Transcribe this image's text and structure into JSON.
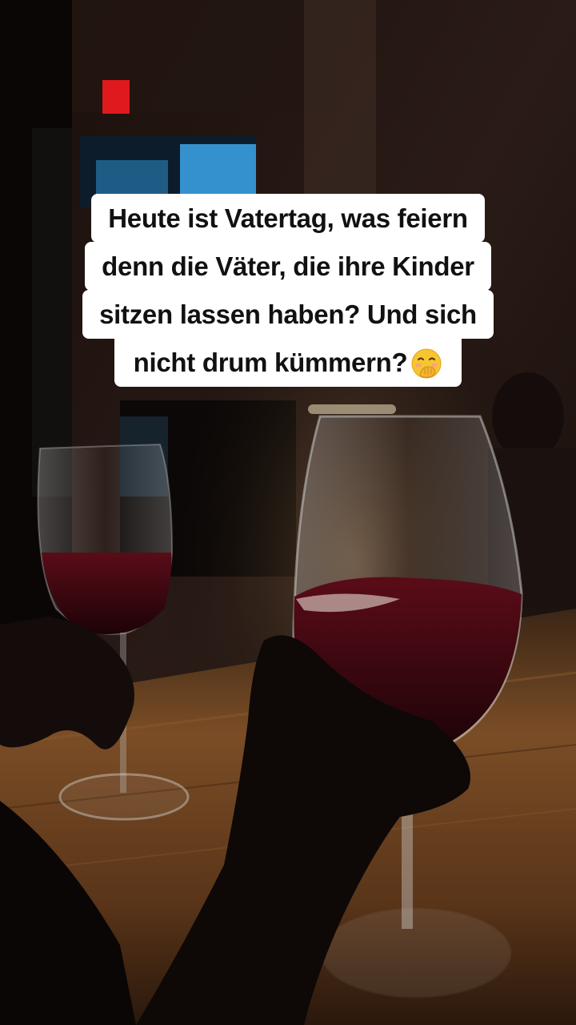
{
  "caption": {
    "lines": [
      "Heute ist Vatertag, was feiern",
      "denn die Väter, die ihre Kinder",
      "sitzen lassen haben? Und sich",
      "nicht drum kümmern?"
    ],
    "emoji": "hand-over-mouth-emoji"
  },
  "colors": {
    "caption_background": "#ffffff",
    "caption_text": "#111111",
    "wine": "#3a0610",
    "exit_sign": "#e0191c",
    "window_glow": "#3a9fe0",
    "bar_wood": "#6b4220"
  }
}
